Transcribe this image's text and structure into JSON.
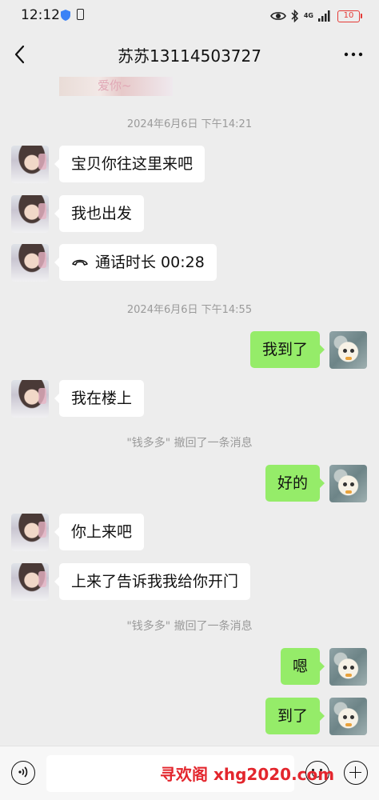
{
  "status_bar": {
    "time": "12:12",
    "network": "4G",
    "battery": "10"
  },
  "header": {
    "title": "苏苏13114503727",
    "more_label": "···"
  },
  "messages": {
    "ts1": "2024年6月6日 下午14:21",
    "m1": "宝贝你往这里来吧",
    "m2": "我也出发",
    "m3_call": "通话时长 00:28",
    "ts2": "2024年6月6日 下午14:55",
    "m4": "我到了",
    "m5": "我在楼上",
    "recall1": "\"钱多多\" 撤回了一条消息",
    "m6": "好的",
    "m7": "你上来吧",
    "m8": "上来了告诉我我给你开门",
    "recall2": "\"钱多多\" 撤回了一条消息",
    "m9": "嗯",
    "m10": "到了",
    "prev_image_text": "爱你~"
  },
  "input_bar": {
    "placeholder": ""
  },
  "watermark": "寻欢阁 xhg2020.com",
  "colors": {
    "background": "#ededed",
    "outgoing_bubble": "#95ec69",
    "incoming_bubble": "#ffffff",
    "system_text": "#9a9a9a",
    "watermark": "#e3262d"
  },
  "icons": {
    "back": "chevron-left-icon",
    "more": "more-dots-icon",
    "call": "phone-hangup-icon",
    "voice": "voice-icon",
    "emoji": "emoji-icon",
    "plus": "plus-icon"
  }
}
